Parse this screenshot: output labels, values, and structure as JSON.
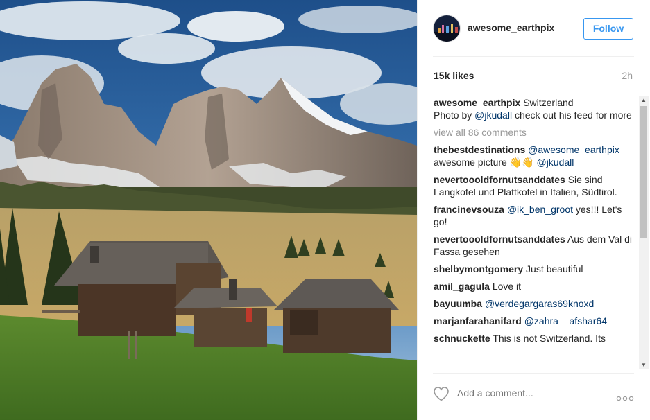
{
  "post": {
    "username": "awesome_earthpix",
    "follow_label": "Follow",
    "likes": "15k likes",
    "time": "2h",
    "caption_location": "Switzerland",
    "caption_prefix": "Photo by ",
    "caption_mention": "@jkudall",
    "caption_suffix": " check out his feed for more",
    "view_all": "view all 86 comments",
    "add_comment_placeholder": "Add a comment..."
  },
  "comments": [
    {
      "user": "thebestdestinations",
      "mention": "@awesome_earthpix",
      "text": " awesome picture 👋👋 ",
      "mention2": "@jkudall"
    },
    {
      "user": "nevertoooldfornutsanddates",
      "text": "Sie sind Langkofel und Plattkofel in Italien, Südtirol."
    },
    {
      "user": "francinevsouza",
      "mention": "@ik_ben_groot",
      "text": " yes!!! Let's go!"
    },
    {
      "user": "nevertoooldfornutsanddates",
      "text": "Aus dem Val di Fassa gesehen"
    },
    {
      "user": "shelbymontgomery",
      "text": "Just beautiful"
    },
    {
      "user": "amil_gagula",
      "text": "Love it"
    },
    {
      "user": "bayuumba",
      "mention": "@verdegargaras69knoxd"
    },
    {
      "user": "marjanfarahanifard",
      "mention": "@zahra__afshar64"
    },
    {
      "user": "schnuckette",
      "text": "This is not Switzerland. Its"
    }
  ],
  "icons": {
    "heart": "heart-icon",
    "more": "more-options-icon",
    "scroll_up": "▲",
    "scroll_down": "▼"
  },
  "colors": {
    "follow_blue": "#3897f0",
    "mention": "#003569",
    "muted": "#999999"
  }
}
